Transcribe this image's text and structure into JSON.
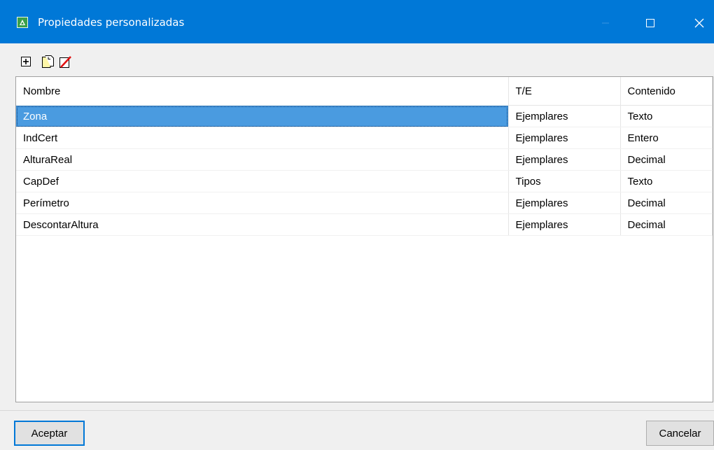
{
  "window": {
    "title": "Propiedades personalizadas",
    "minimize_glyph": "—",
    "maximize_glyph": "☐",
    "close_glyph": "✕",
    "titlebar_color": "#0078d7"
  },
  "toolbar": {
    "icons": [
      "add-icon",
      "copy-icon",
      "delete-icon"
    ]
  },
  "table": {
    "columns": [
      "Nombre",
      "T/E",
      "Contenido"
    ],
    "rows": [
      {
        "name": "Zona",
        "te": "Ejemplares",
        "content": "Texto"
      },
      {
        "name": "IndCert",
        "te": "Ejemplares",
        "content": "Entero"
      },
      {
        "name": "AlturaReal",
        "te": "Ejemplares",
        "content": "Decimal"
      },
      {
        "name": "CapDef",
        "te": "Tipos",
        "content": "Texto"
      },
      {
        "name": "Perímetro",
        "te": "Ejemplares",
        "content": "Decimal"
      },
      {
        "name": "DescontarAltura",
        "te": "Ejemplares",
        "content": "Decimal"
      }
    ],
    "selected_index": 0,
    "selection_color": "#4a9be0"
  },
  "buttons": {
    "accept": "Aceptar",
    "cancel": "Cancelar"
  }
}
